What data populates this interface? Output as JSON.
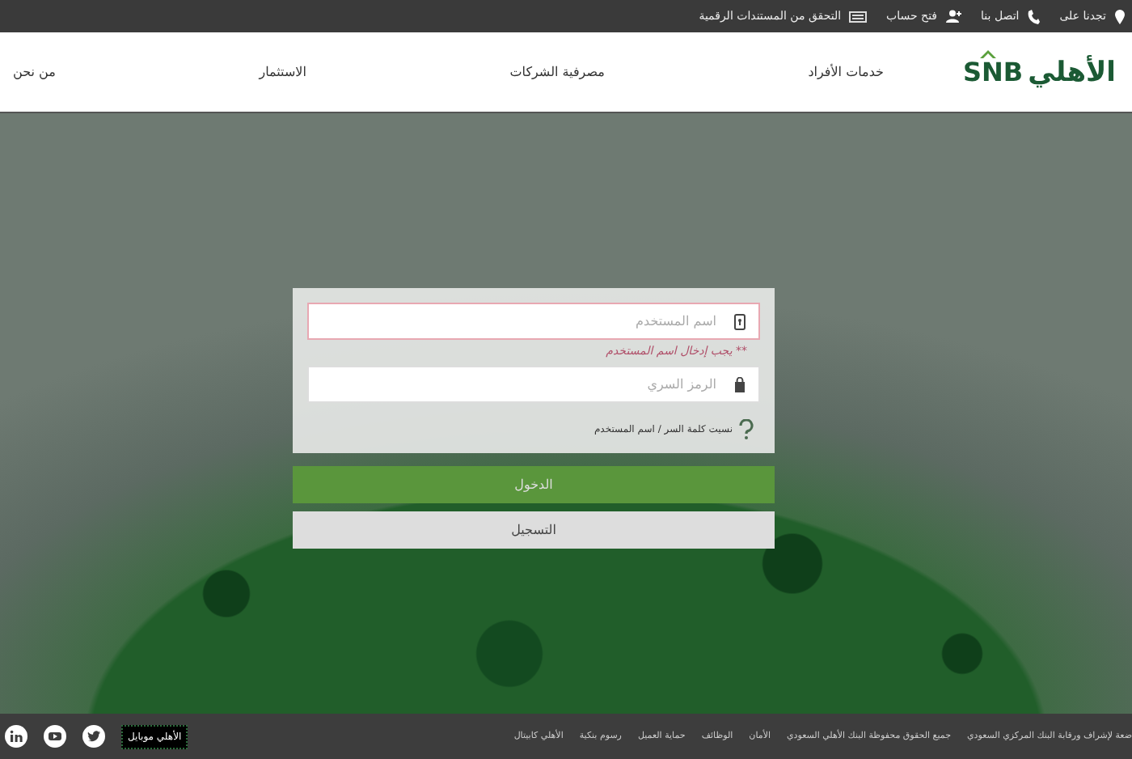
{
  "top_bar": {
    "links": [
      {
        "label": "تجدنا على"
      },
      {
        "label": "اتصل بنا"
      },
      {
        "label": "فتح حساب"
      },
      {
        "label": "التحقق من المستندات الرقمية"
      }
    ]
  },
  "header": {
    "logo": {
      "text": "الأهلي",
      "mark": "SNB"
    },
    "nav": [
      "خدمات الأفراد",
      "مصرفية الشركات",
      "الاستثمار",
      "من نحن"
    ]
  },
  "login": {
    "username": {
      "placeholder": "اسم المستخدم",
      "invalid": true
    },
    "error": "** يجب إدخال اسم المستخدم",
    "password": {
      "placeholder": "الرمز السري"
    },
    "forgot": "نسيت كلمة السر / اسم المستخدم",
    "buttons": [
      {
        "label": "الدخول",
        "kind": "primary"
      },
      {
        "label": "التسجيل",
        "kind": "secondary"
      }
    ]
  },
  "footer": {
    "links": [
      "ضعة لإشراف ورقابة البنك المركزي السعودي",
      "جميع الحقوق محفوظة البنك الأهلي السعودي",
      "الأمان",
      "الوظائف",
      "حماية العميل",
      "رسوم بنكية",
      "الأهلي كابيتال"
    ],
    "app_badge": "الأهلي موبايل"
  }
}
